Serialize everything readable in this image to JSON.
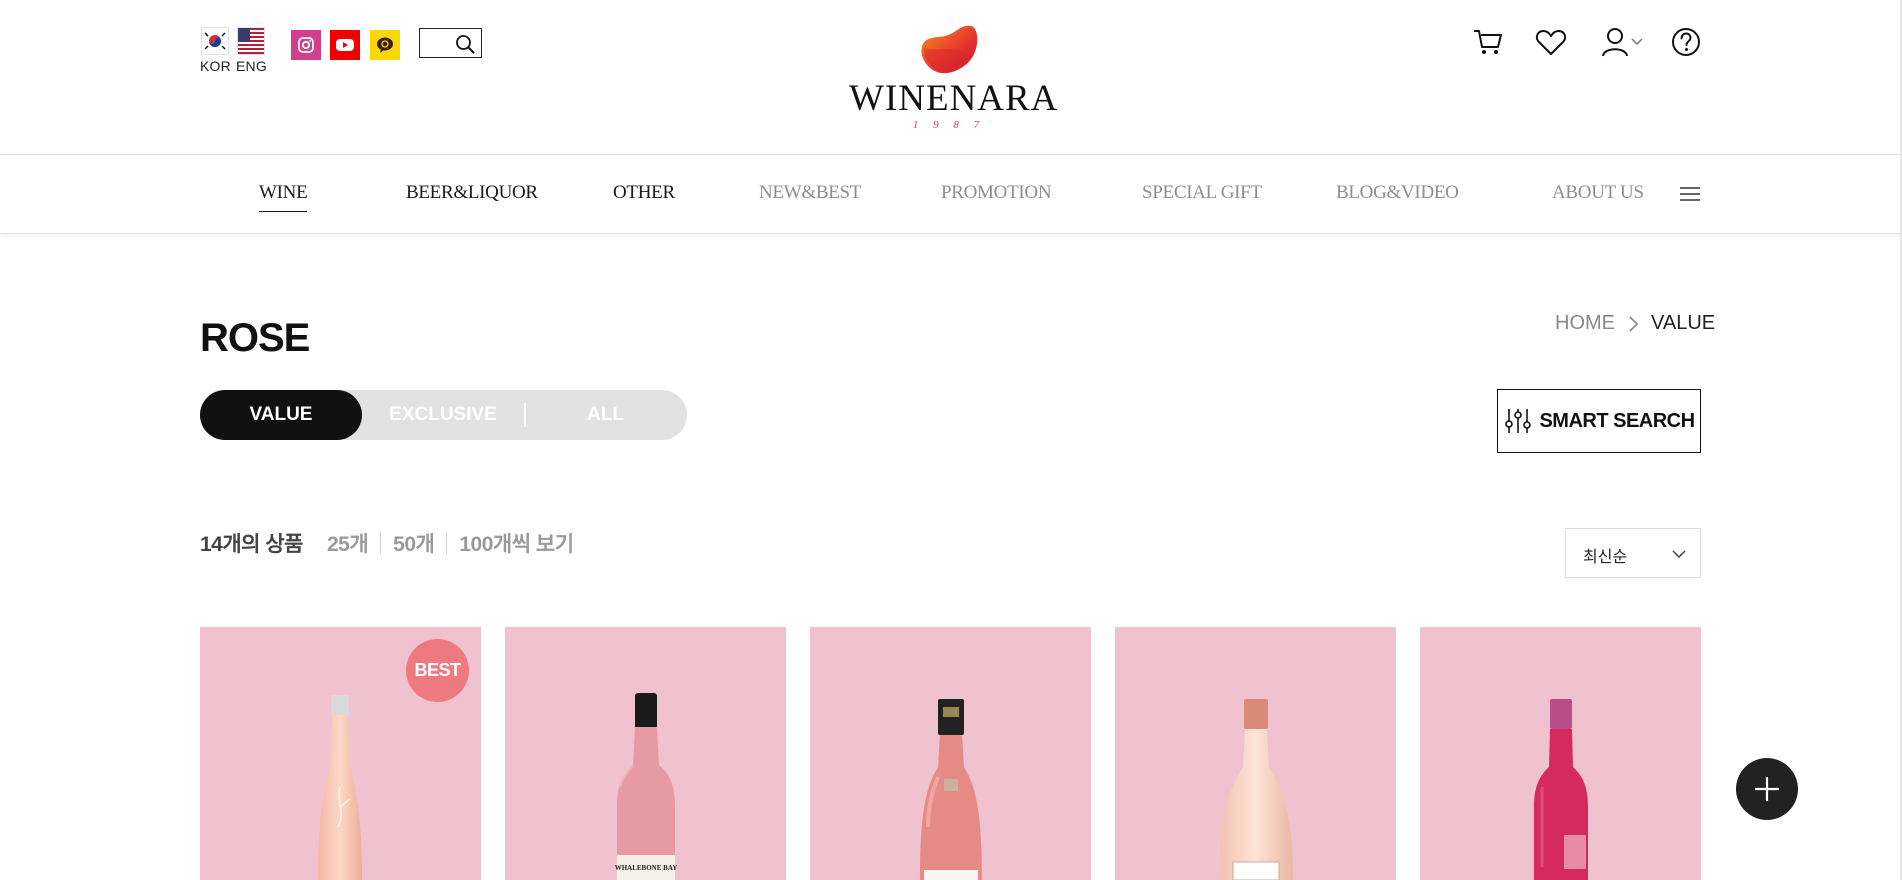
{
  "header": {
    "languages": [
      {
        "code": "KOR",
        "icon": "korea-flag-icon"
      },
      {
        "code": "ENG",
        "icon": "usa-flag-icon"
      }
    ],
    "sns": [
      {
        "name": "instagram",
        "icon": "instagram-icon",
        "color": "#d43f8d"
      },
      {
        "name": "youtube",
        "icon": "youtube-icon",
        "color": "#ee0000"
      },
      {
        "name": "kakao channel",
        "icon": "kakao-channel-icon",
        "color": "#f7d900"
      }
    ],
    "search": {
      "value": "",
      "placeholder": ""
    },
    "logo": {
      "text": "WINENARA",
      "year": "1 9 8 7"
    },
    "utility_icons": [
      "cart-icon",
      "heart-icon",
      "user-icon",
      "help-icon"
    ]
  },
  "nav": {
    "items": [
      {
        "label": "WINE",
        "active": true
      },
      {
        "label": "BEER&LIQUOR",
        "active": false
      },
      {
        "label": "OTHER",
        "active": false
      },
      {
        "label": "NEW&BEST",
        "active": false
      },
      {
        "label": "PROMOTION",
        "active": false
      },
      {
        "label": "SPECIAL GIFT",
        "active": false
      },
      {
        "label": "BLOG&VIDEO",
        "active": false
      },
      {
        "label": "ABOUT US",
        "active": false
      }
    ],
    "menu_icon": "hamburger-menu-icon"
  },
  "page": {
    "title": "ROSE",
    "breadcrumb": {
      "home": "HOME",
      "current": "VALUE"
    }
  },
  "tabs": [
    {
      "label": "VALUE",
      "active": true
    },
    {
      "label": "EXCLUSIVE",
      "active": false
    },
    {
      "label": "ALL",
      "active": false
    }
  ],
  "smart_search": {
    "label": "SMART SEARCH",
    "icon": "filter-sliders-icon"
  },
  "count_bar": {
    "total": "14개의 상품",
    "options": [
      "25개",
      "50개",
      "100개씩 보기"
    ]
  },
  "sort": {
    "selected": "최신순"
  },
  "products": [
    {
      "badge": "BEST",
      "bottle_label": ""
    },
    {
      "badge": "",
      "bottle_label": "WHALEBONE BAY"
    },
    {
      "badge": "",
      "bottle_label": ""
    },
    {
      "badge": "",
      "bottle_label": ""
    },
    {
      "badge": "",
      "bottle_label": ""
    }
  ],
  "colors": {
    "product_bg": "#f0c2cf",
    "best_badge": "#ee7a80",
    "active_tab": "#111111",
    "tab_bg": "#e2e2e2",
    "accent_red": "#c9444f"
  }
}
